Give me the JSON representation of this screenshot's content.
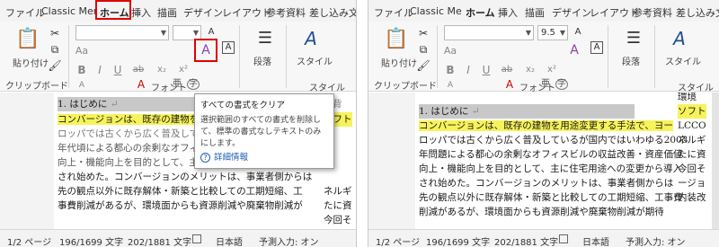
{
  "tabs": [
    "ファイル",
    "Classic Menu",
    "ホーム",
    "挿入",
    "描画",
    "デザイン",
    "レイアウト",
    "参考資料",
    "差し込み文"
  ],
  "ribbon": {
    "paste_label": "貼り付け",
    "clipboard_label": "クリップボード",
    "font_label": "フォント",
    "paragraph_label": "段落",
    "style_label": "スタイル",
    "style_group_label": "スタイル",
    "font_size_value": "9.5",
    "a_glyph": "A",
    "aa_glyph": "Aa",
    "bold_glyph": "B",
    "italic_glyph": "I",
    "underline_glyph": "U",
    "strike_glyph": "ab",
    "sub_glyph": "x₂",
    "sup_glyph": "x²",
    "ruby_glyph": "亜",
    "enclosed_glyph": "字"
  },
  "tooltip": {
    "title": "すべての書式をクリア",
    "body": "選択範囲のすべての書式を削除して、標準の書式なしテキストのみにします。",
    "link": "詳細情報"
  },
  "document": {
    "heading": "1. はじめに",
    "return_mark": "↵",
    "left_lines": [
      "コンバージョンは、既存の建物を",
      "ロッパでは古くから広く普及して",
      "年代頃による都心の余剰なオフィス",
      "向上・機能向上を目的として、主",
      "され始めた。コンバージョンのメリットは、事業者側からは",
      "先の観点以外に既存解体・新築と比較しての工期短縮、工",
      "事費削減があるが、環境面からも資源削減や廃棄物削減が"
    ],
    "left_right_col": [
      "ソフト",
      "ネルギ",
      "たに資",
      "今回そ"
    ],
    "left_margin_char": "背",
    "right_lines": [
      "コンバージョンは、既存の建物を用途変更する手法で、ヨー",
      "ロッパでは古くから広く普及しているが国内ではいわゆる2003",
      "年問題による都心の余剰なオフィスビルの収益改善・資産価値",
      "向上・機能向上を目的として、主に住宅用途への変更から導入",
      "され始めた。コンバージョンのメリットは、事業者側からは",
      "先の観点以外に既存解体・新築と比較しての工期短縮、工事費",
      "削減があるが、環境面からも資源削減や廃棄物削減が期待"
    ],
    "right_side_col": [
      "環境",
      "ソフト",
      "LCCO",
      "ネルギ",
      "たに資",
      "今回そ",
      "ージョ",
      "内装改"
    ]
  },
  "status": {
    "page": "1/2 ページ",
    "words_left": "196/1699 文字",
    "chars_left": "202/1881 文字",
    "lang": "日本語",
    "predict": "予測入力: オン",
    "words_right": "196/1699 文字",
    "chars_right": "202/1881 文字"
  }
}
